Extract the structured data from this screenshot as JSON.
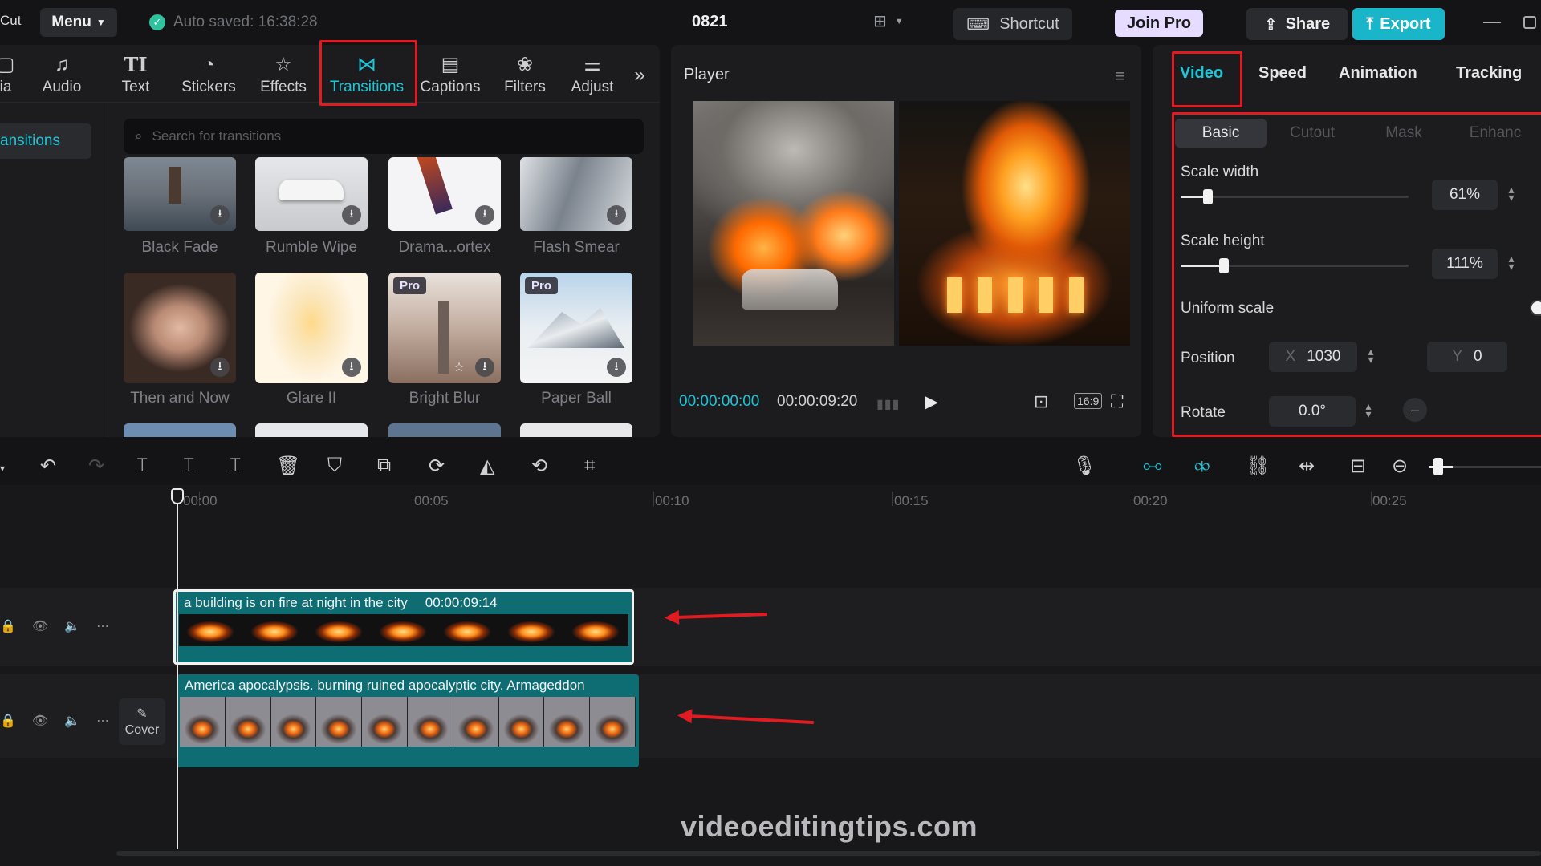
{
  "topbar": {
    "app_name": "Cut",
    "menu_label": "Menu",
    "autosave_text": "Auto saved: 16:38:28",
    "project_title": "0821",
    "shortcut_label": "Shortcut",
    "join_pro_label": "Join Pro",
    "share_label": "Share",
    "export_label": "Export"
  },
  "tool_tabs": [
    {
      "label": "ia",
      "icon": "media-icon"
    },
    {
      "label": "Audio",
      "icon": "audio-icon"
    },
    {
      "label": "Text",
      "icon": "text-icon"
    },
    {
      "label": "Stickers",
      "icon": "stickers-icon"
    },
    {
      "label": "Effects",
      "icon": "effects-icon"
    },
    {
      "label": "Transitions",
      "icon": "transitions-icon",
      "active": true
    },
    {
      "label": "Captions",
      "icon": "captions-icon"
    },
    {
      "label": "Filters",
      "icon": "filters-icon"
    },
    {
      "label": "Adjust",
      "icon": "adjust-icon"
    }
  ],
  "side_nav": {
    "active_label": "ansitions"
  },
  "search": {
    "placeholder": "Search for transitions"
  },
  "transitions": [
    {
      "label": "Black Fade",
      "pro": false
    },
    {
      "label": "Rumble Wipe",
      "pro": false
    },
    {
      "label": "Drama...ortex",
      "pro": false
    },
    {
      "label": "Flash Smear",
      "pro": false
    },
    {
      "label": "Then and Now",
      "pro": false
    },
    {
      "label": "Glare II",
      "pro": false
    },
    {
      "label": "Bright Blur",
      "pro": true
    },
    {
      "label": "Paper Ball",
      "pro": true
    }
  ],
  "pro_badge": "Pro",
  "player": {
    "title": "Player",
    "current_time": "00:00:00:00",
    "total_time": "00:00:09:20",
    "ratio": "16:9"
  },
  "right_panel": {
    "tabs": [
      "Video",
      "Speed",
      "Animation",
      "Tracking"
    ],
    "active_tab": "Video",
    "sub_tabs": [
      "Basic",
      "Cutout",
      "Mask",
      "Enhanc"
    ],
    "active_sub_tab": "Basic",
    "scale_width_label": "Scale width",
    "scale_width_value": "61%",
    "scale_width_fraction": 0.12,
    "scale_height_label": "Scale height",
    "scale_height_value": "111%",
    "scale_height_fraction": 0.19,
    "uniform_scale_label": "Uniform scale",
    "position_label": "Position",
    "position_x_axis": "X",
    "position_x": "1030",
    "position_y_axis": "Y",
    "position_y": "0",
    "rotate_label": "Rotate",
    "rotate_value": "0.0°"
  },
  "timeline": {
    "ruler": [
      "00:00",
      "00:05",
      "00:10",
      "00:15",
      "00:20",
      "00:25"
    ],
    "cover_label": "Cover",
    "clips": [
      {
        "title": "a building is on fire at night in the city",
        "duration": "00:00:09:14",
        "selected": true
      },
      {
        "title": "America apocalypsis. burning ruined apocalyptic city. Armageddon",
        "duration": "",
        "selected": false
      }
    ]
  },
  "watermark": "videoeditingtips.com",
  "colors": {
    "accent": "#1fc4d6",
    "highlight_box": "#e11b22",
    "clip": "#0e6d73",
    "export": "#19b6c9",
    "join_pro": "#e5dcff"
  }
}
